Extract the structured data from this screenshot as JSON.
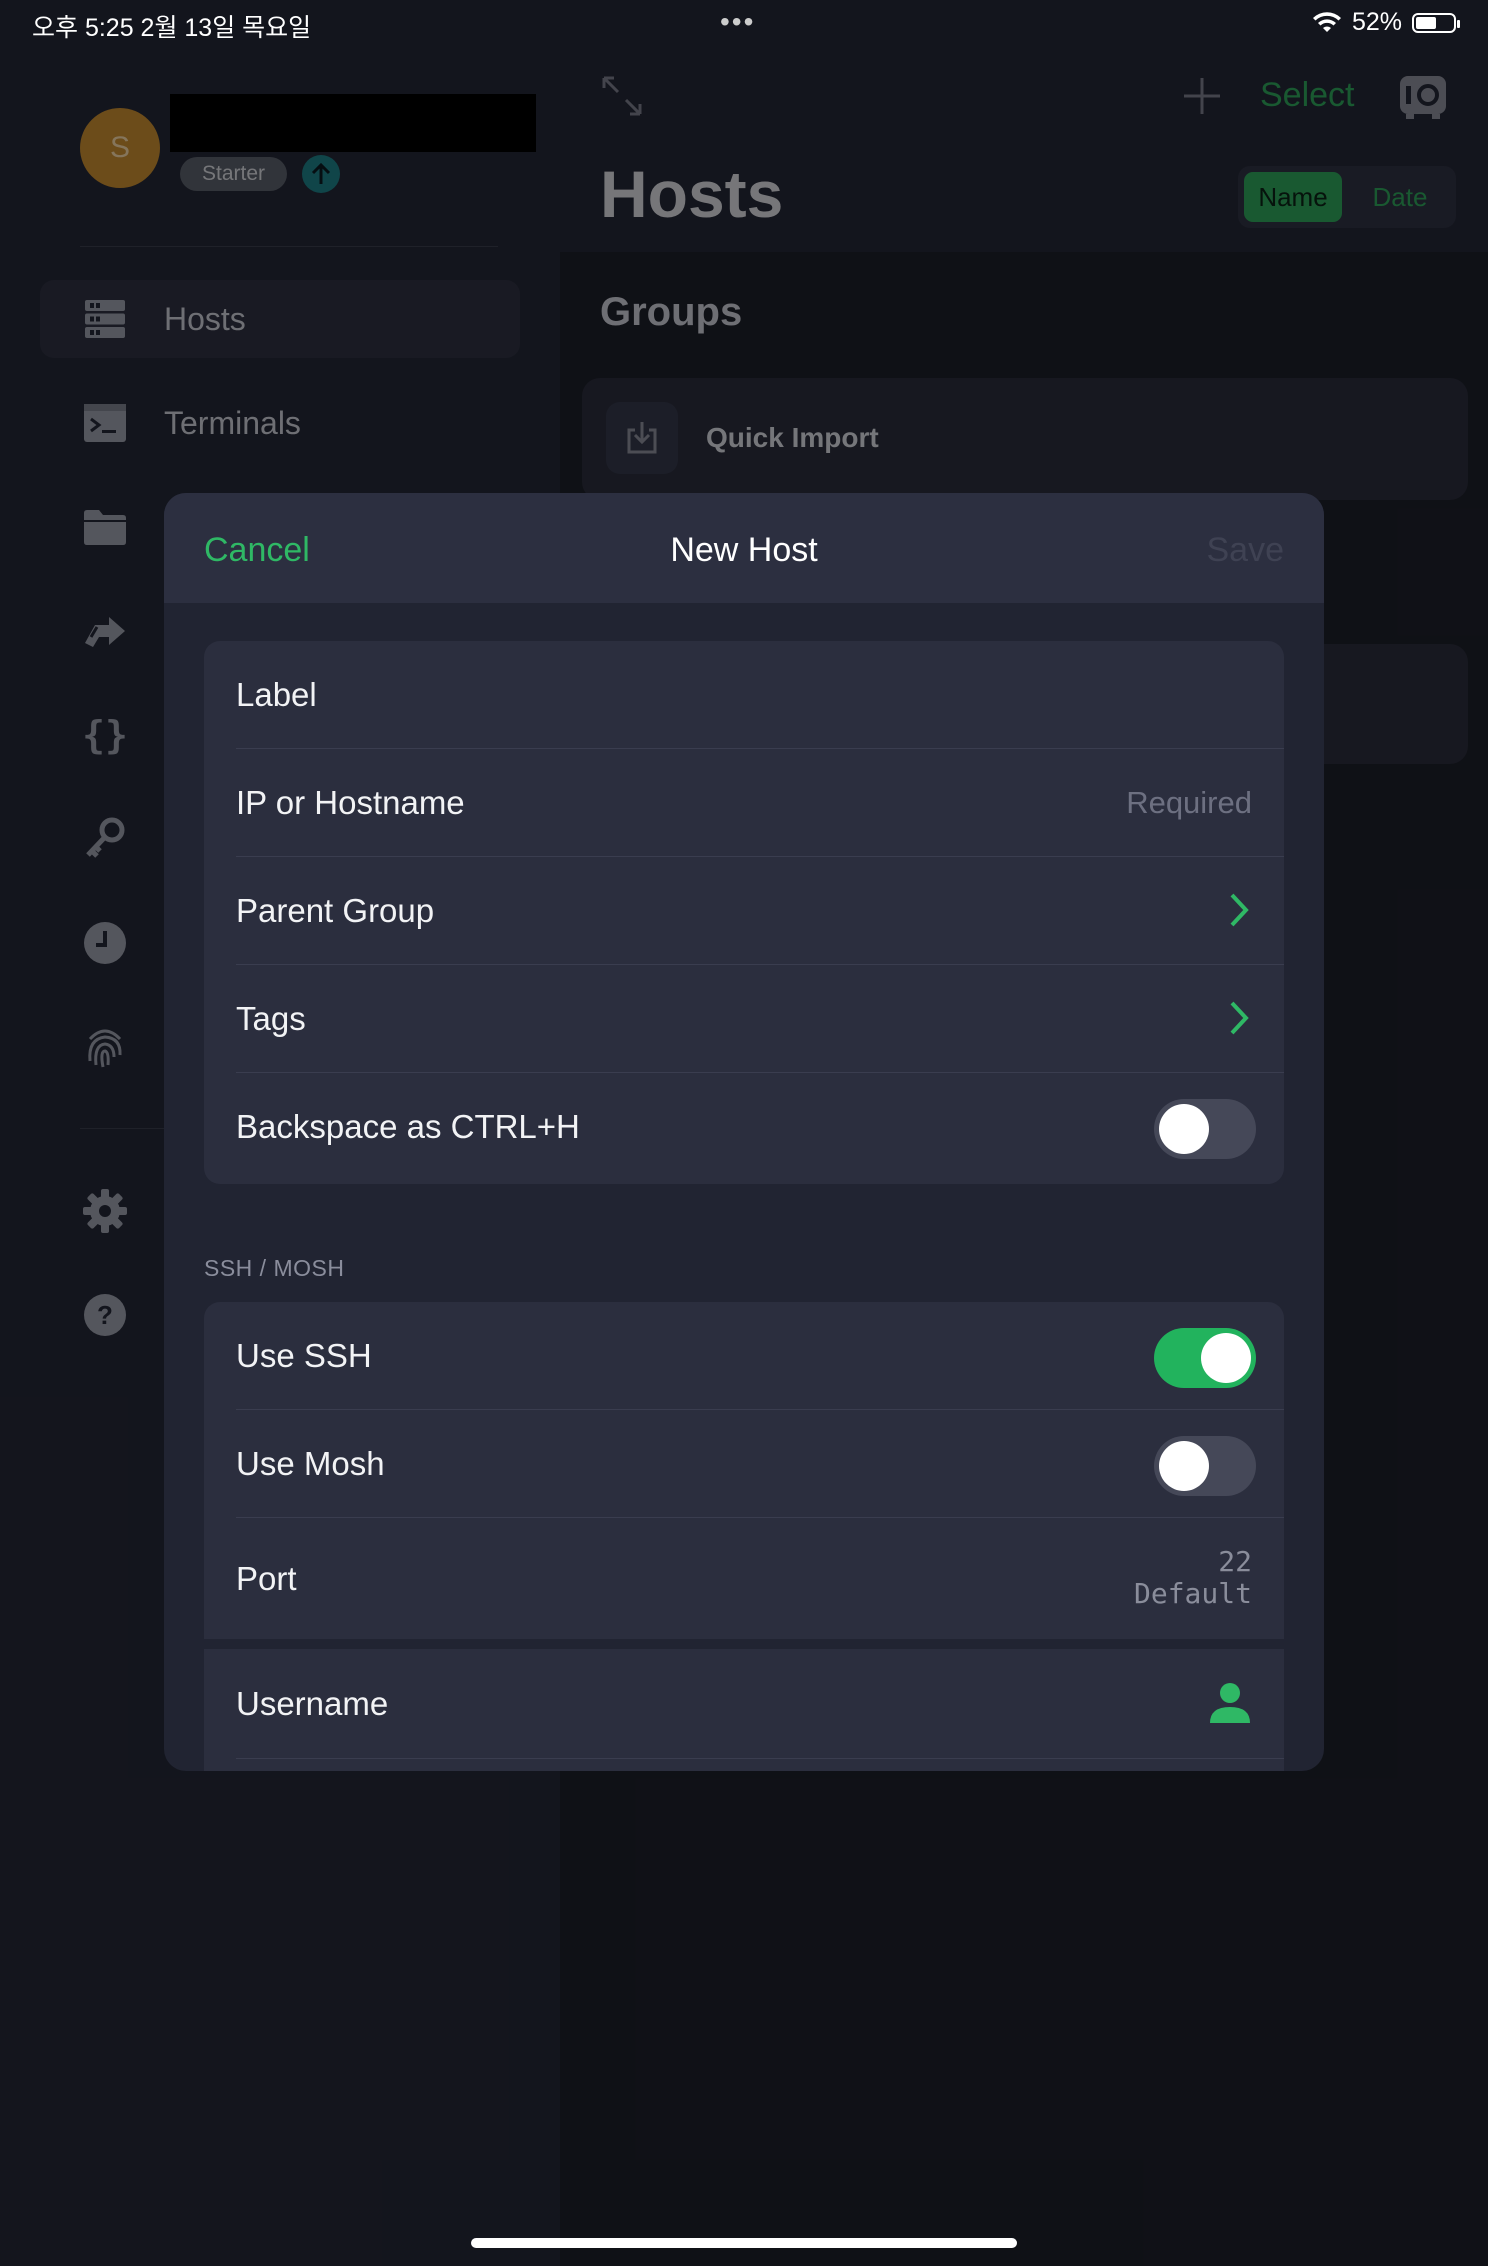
{
  "status": {
    "time": "오후 5:25   2월 13일 목요일",
    "battery": "52%",
    "battery_level": 0.52
  },
  "user": {
    "initial": "S",
    "plan": "Starter"
  },
  "sidebar": {
    "items": [
      {
        "label": "Hosts",
        "icon": "server-icon",
        "active": true
      },
      {
        "label": "Terminals",
        "icon": "terminal-icon"
      },
      {
        "label": "",
        "icon": "folder-icon"
      },
      {
        "label": "",
        "icon": "port-forwarding-icon"
      },
      {
        "label": "",
        "icon": "snippets-icon"
      },
      {
        "label": "",
        "icon": "key-icon"
      },
      {
        "label": "",
        "icon": "history-icon"
      },
      {
        "label": "",
        "icon": "fingerprint-icon"
      },
      {
        "label": "",
        "icon": "gear-icon"
      },
      {
        "label": "",
        "icon": "help-icon"
      }
    ]
  },
  "main": {
    "title": "Hosts",
    "select_label": "Select",
    "sort": {
      "options": [
        "Name",
        "Date"
      ],
      "selected": "Name"
    },
    "groups_title": "Groups",
    "quick_import": "Quick Import"
  },
  "modal": {
    "cancel": "Cancel",
    "title": "New Host",
    "save": "Save",
    "general": {
      "label": "Label",
      "hostname": "IP or Hostname",
      "hostname_placeholder": "Required",
      "parent_group": "Parent Group",
      "tags": "Tags",
      "backspace": "Backspace as CTRL+H",
      "backspace_on": false
    },
    "ssh_section": "SSH / MOSH",
    "ssh": {
      "use_ssh": "Use SSH",
      "use_ssh_on": true,
      "use_mosh": "Use Mosh",
      "use_mosh_on": false,
      "port": "Port",
      "port_value": "22",
      "port_default": "Default",
      "username": "Username"
    }
  },
  "colors": {
    "accent": "#2fb865",
    "background": "#1d1f29",
    "modal": "#212432"
  }
}
